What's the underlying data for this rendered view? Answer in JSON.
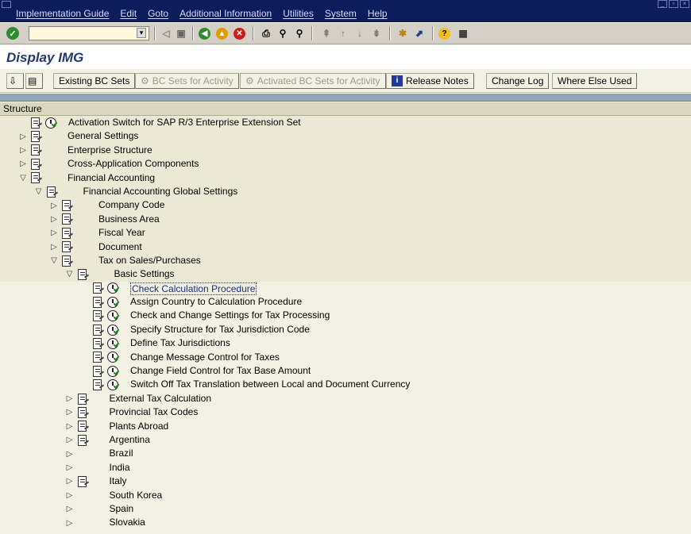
{
  "menubar": {
    "items": [
      "Implementation Guide",
      "Edit",
      "Goto",
      "Additional Information",
      "Utilities",
      "System",
      "Help"
    ]
  },
  "toolbar": {
    "command_value": ""
  },
  "title": "Display IMG",
  "app_toolbar": {
    "buttons": [
      {
        "label": "Existing BC Sets",
        "enabled": true
      },
      {
        "label": "BC Sets for Activity",
        "enabled": false
      },
      {
        "label": "Activated BC Sets for Activity",
        "enabled": false
      },
      {
        "label": "Release Notes",
        "enabled": true
      },
      {
        "label": "Change Log",
        "enabled": true
      },
      {
        "label": "Where Else Used",
        "enabled": true
      }
    ]
  },
  "structure": {
    "header": "Structure",
    "rows": [
      {
        "label": "Activation Switch for SAP R/3 Enterprise Extension Set",
        "level": 0,
        "expander": "none",
        "doc": true,
        "clock": true
      },
      {
        "label": "General Settings",
        "level": 0,
        "expander": "collapsed",
        "doc": true,
        "clock": false
      },
      {
        "label": "Enterprise Structure",
        "level": 0,
        "expander": "collapsed",
        "doc": true,
        "clock": false
      },
      {
        "label": "Cross-Application Components",
        "level": 0,
        "expander": "collapsed",
        "doc": true,
        "clock": false
      },
      {
        "label": "Financial Accounting",
        "level": 0,
        "expander": "expanded",
        "doc": true,
        "clock": false
      },
      {
        "label": "Financial Accounting Global Settings",
        "level": 1,
        "expander": "expanded",
        "doc": true,
        "clock": false
      },
      {
        "label": "Company Code",
        "level": 2,
        "expander": "collapsed",
        "doc": true,
        "clock": false
      },
      {
        "label": "Business Area",
        "level": 2,
        "expander": "collapsed",
        "doc": true,
        "clock": false
      },
      {
        "label": "Fiscal Year",
        "level": 2,
        "expander": "collapsed",
        "doc": true,
        "clock": false
      },
      {
        "label": "Document",
        "level": 2,
        "expander": "collapsed",
        "doc": true,
        "clock": false
      },
      {
        "label": "Tax on Sales/Purchases",
        "level": 2,
        "expander": "expanded",
        "doc": true,
        "clock": false
      },
      {
        "label": "Basic Settings",
        "level": 3,
        "expander": "expanded",
        "doc": true,
        "clock": false
      },
      {
        "label": "Check Calculation Procedure",
        "level": 4,
        "expander": "none",
        "doc": true,
        "clock": true,
        "selected": true
      },
      {
        "label": "Assign Country to Calculation Procedure",
        "level": 4,
        "expander": "none",
        "doc": true,
        "clock": true
      },
      {
        "label": "Check and Change Settings for Tax Processing",
        "level": 4,
        "expander": "none",
        "doc": true,
        "clock": true
      },
      {
        "label": "Specify Structure for Tax Jurisdiction Code",
        "level": 4,
        "expander": "none",
        "doc": true,
        "clock": true
      },
      {
        "label": "Define Tax Jurisdictions",
        "level": 4,
        "expander": "none",
        "doc": true,
        "clock": true
      },
      {
        "label": "Change Message Control for Taxes",
        "level": 4,
        "expander": "none",
        "doc": true,
        "clock": true
      },
      {
        "label": "Change Field Control for Tax Base Amount",
        "level": 4,
        "expander": "none",
        "doc": true,
        "clock": true
      },
      {
        "label": "Switch Off Tax Translation between Local and Document Currency",
        "level": 4,
        "expander": "none",
        "doc": true,
        "clock": true
      },
      {
        "label": "External Tax Calculation",
        "level": 3,
        "expander": "collapsed",
        "doc": true,
        "clock": false,
        "text_indent": true
      },
      {
        "label": "Provincial Tax Codes",
        "level": 3,
        "expander": "collapsed",
        "doc": true,
        "clock": false,
        "text_indent": true
      },
      {
        "label": "Plants Abroad",
        "level": 3,
        "expander": "collapsed",
        "doc": true,
        "clock": false,
        "text_indent": true
      },
      {
        "label": "Argentina",
        "level": 3,
        "expander": "collapsed",
        "doc": true,
        "clock": false,
        "text_indent": true
      },
      {
        "label": "Brazil",
        "level": 3,
        "expander": "collapsed",
        "doc": false,
        "clock": false,
        "text_indent": true
      },
      {
        "label": "India",
        "level": 3,
        "expander": "collapsed",
        "doc": false,
        "clock": false,
        "text_indent": true
      },
      {
        "label": "Italy",
        "level": 3,
        "expander": "collapsed",
        "doc": true,
        "clock": false,
        "text_indent": true
      },
      {
        "label": "South Korea",
        "level": 3,
        "expander": "collapsed",
        "doc": false,
        "clock": false,
        "text_indent": true
      },
      {
        "label": "Spain",
        "level": 3,
        "expander": "collapsed",
        "doc": false,
        "clock": false,
        "text_indent": true
      },
      {
        "label": "Slovakia",
        "level": 3,
        "expander": "collapsed",
        "doc": false,
        "clock": false,
        "text_indent": true
      }
    ]
  }
}
